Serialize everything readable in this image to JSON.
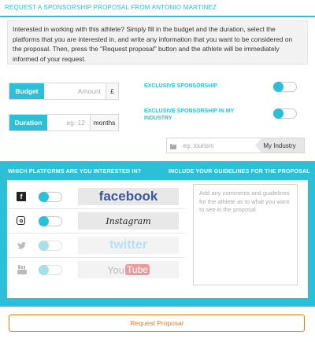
{
  "header": {
    "title": "REQUEST A SPONSORSHIP PROPOSAL FROM ANTONIO MARTINEZ"
  },
  "intro": {
    "text": "Interested in working with this athlete? Simply fill in the budget and the duration, select the platforms that you are interested in, and write any information that you want to be considered on the proposal. Then, press the \"Request proposal\" button and the athlete will be immediately informed of your request."
  },
  "budget": {
    "label": "Budget",
    "placeholder": "Amount",
    "unit": "£"
  },
  "duration": {
    "label": "Duration",
    "placeholder": "eg: 12",
    "unit": "months"
  },
  "options": {
    "exclusive": {
      "label": "EXCLUSIVE SPONSORSHIP",
      "on": false
    },
    "exclusive_industry": {
      "label": "EXCLUSIVE SPONSORSHIP IN MY INDUSTRY",
      "on": false
    }
  },
  "industry": {
    "placeholder": "eg: tourism",
    "button_label": "My Industry",
    "icon": "industry-icon"
  },
  "platforms_section": {
    "title": "WHICH PLATFORMS ARE YOU INTERESTED IN?",
    "guidelines_title": "INCLUDE YOUR GUIDELINES FOR THE PROPOSAL",
    "guidelines_placeholder": "Add any comments and guidelines for the athlete as to what you want to see in the proposal"
  },
  "platforms": [
    {
      "name": "facebook",
      "icon": "facebook-icon",
      "enabled": true,
      "color": "#3b5998"
    },
    {
      "name": "Instagram",
      "icon": "instagram-icon",
      "enabled": true,
      "color": "#222222"
    },
    {
      "name": "twitter",
      "icon": "twitter-icon",
      "enabled": false,
      "color": "#55acee"
    },
    {
      "name": "You",
      "name_suffix": "Tube",
      "icon": "youtube-icon",
      "enabled": false,
      "color": "#cc181e"
    }
  ],
  "request_button": {
    "label": "Request Proposal"
  },
  "colors": {
    "accent": "#2bc0d8",
    "action": "#f07b1e"
  }
}
